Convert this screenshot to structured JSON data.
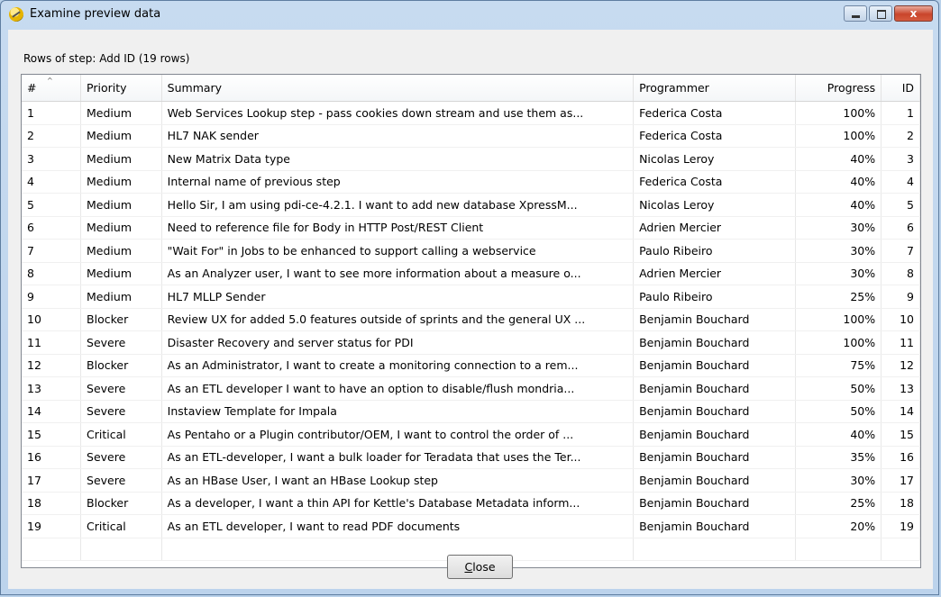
{
  "window": {
    "title": "Examine preview data",
    "close_label": "x"
  },
  "rows_label": "Rows of step: Add ID (19 rows)",
  "columns": [
    "#",
    "Priority",
    "Summary",
    "Programmer",
    "Progress",
    "ID"
  ],
  "rows": [
    [
      "1",
      "Medium",
      "Web Services Lookup step - pass cookies down stream and use them as...",
      "Federica Costa",
      "100%",
      "1"
    ],
    [
      "2",
      "Medium",
      "HL7 NAK sender",
      "Federica Costa",
      "100%",
      "2"
    ],
    [
      "3",
      "Medium",
      "New Matrix Data type",
      "Nicolas Leroy",
      "40%",
      "3"
    ],
    [
      "4",
      "Medium",
      "Internal name of previous step",
      "Federica Costa",
      "40%",
      "4"
    ],
    [
      "5",
      "Medium",
      "Hello Sir, I am using pdi-ce-4.2.1. I want to add new database XpressM...",
      "Nicolas Leroy",
      "40%",
      "5"
    ],
    [
      "6",
      "Medium",
      "Need to reference file for Body in HTTP Post/REST Client",
      "Adrien Mercier",
      "30%",
      "6"
    ],
    [
      "7",
      "Medium",
      "\"Wait For\" in Jobs to be enhanced to support calling a webservice",
      "Paulo Ribeiro",
      "30%",
      "7"
    ],
    [
      "8",
      "Medium",
      "As an Analyzer user, I want to see more information about a measure o...",
      "Adrien Mercier",
      "30%",
      "8"
    ],
    [
      "9",
      "Medium",
      "HL7 MLLP Sender",
      "Paulo Ribeiro",
      "25%",
      "9"
    ],
    [
      "10",
      "Blocker",
      "Review UX for added 5.0 features outside of sprints and the general UX ...",
      "Benjamin Bouchard",
      "100%",
      "10"
    ],
    [
      "11",
      "Severe",
      "Disaster Recovery and server status for PDI",
      "Benjamin Bouchard",
      "100%",
      "11"
    ],
    [
      "12",
      "Blocker",
      "As an Administrator, I want to create a monitoring connection to a rem...",
      "Benjamin Bouchard",
      "75%",
      "12"
    ],
    [
      "13",
      "Severe",
      "As an ETL developer I want to have an option to disable/flush mondria...",
      "Benjamin Bouchard",
      "50%",
      "13"
    ],
    [
      "14",
      "Severe",
      "Instaview Template for Impala",
      "Benjamin Bouchard",
      "50%",
      "14"
    ],
    [
      "15",
      "Critical",
      "As Pentaho or a Plugin contributor/OEM, I want to control the order of ...",
      "Benjamin Bouchard",
      "40%",
      "15"
    ],
    [
      "16",
      "Severe",
      "As an ETL-developer, I want a bulk loader for Teradata that uses the Ter...",
      "Benjamin Bouchard",
      "35%",
      "16"
    ],
    [
      "17",
      "Severe",
      "As an HBase User, I want an HBase Lookup step",
      "Benjamin Bouchard",
      "30%",
      "17"
    ],
    [
      "18",
      "Blocker",
      "As a developer, I want a thin API for Kettle's Database Metadata inform...",
      "Benjamin Bouchard",
      "25%",
      "18"
    ],
    [
      "19",
      "Critical",
      "As an ETL developer, I want to read PDF documents",
      "Benjamin Bouchard",
      "20%",
      "19"
    ]
  ],
  "close_button": {
    "mnemonic": "C",
    "rest": "lose"
  },
  "icons": {
    "app": "spoon-icon",
    "sort": "sort-ascending-icon"
  }
}
